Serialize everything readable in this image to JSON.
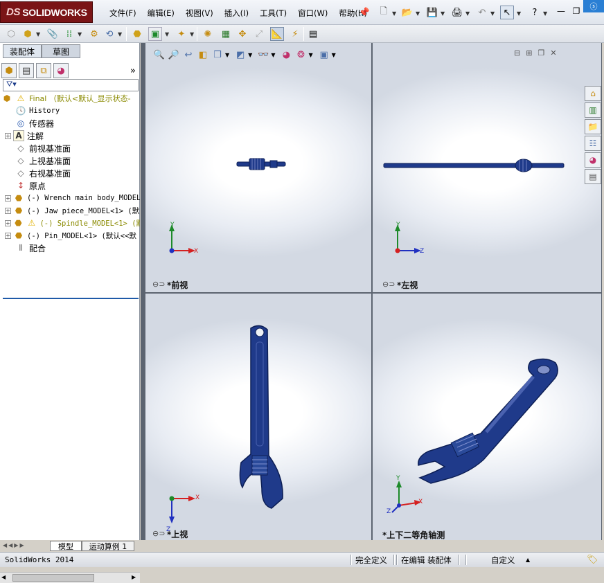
{
  "app": {
    "logo_prefix": "DS",
    "logo_text": "SOLIDWORKS"
  },
  "menu": {
    "items": [
      "文件(F)",
      "编辑(E)",
      "视图(V)",
      "插入(I)",
      "工具(T)",
      "窗口(W)",
      "帮助(H)"
    ]
  },
  "panel_tabs": {
    "assembly": "装配体",
    "sketch": "草图"
  },
  "feature_tree": {
    "root": "Final （默认<默认_显示状态-",
    "items": [
      {
        "label": "History",
        "icon": "history-icon",
        "expander": false
      },
      {
        "label": "传感器",
        "icon": "sensor-icon",
        "expander": false
      },
      {
        "label": "注解",
        "icon": "annotation-icon",
        "expander": true
      },
      {
        "label": "前视基准面",
        "icon": "plane-icon",
        "expander": false
      },
      {
        "label": "上视基准面",
        "icon": "plane-icon",
        "expander": false
      },
      {
        "label": "右视基准面",
        "icon": "plane-icon",
        "expander": false
      },
      {
        "label": "原点",
        "icon": "origin-icon",
        "expander": false
      },
      {
        "label": "(-) Wrench main body_MODEL",
        "icon": "part-icon",
        "expander": true
      },
      {
        "label": "(-) Jaw piece_MODEL<1> (默",
        "icon": "part-icon",
        "expander": true
      },
      {
        "label": "(-) Spindle_MODEL<1> (默",
        "icon": "part-warning-icon",
        "expander": true,
        "warning": true
      },
      {
        "label": "(-) Pin_MODEL<1> (默认<<默",
        "icon": "part-icon",
        "expander": true
      },
      {
        "label": "配合",
        "icon": "mate-icon",
        "expander": false
      }
    ]
  },
  "bottom_tabs": {
    "model": "模型",
    "motion": "运动算例 1"
  },
  "viewports": {
    "front": "*前视",
    "left": "*左视",
    "top": "*上视",
    "iso": "*上下二等角轴测"
  },
  "axes": {
    "x": "X",
    "y": "Y",
    "z": "Z"
  },
  "status": {
    "app_version": "SolidWorks 2014",
    "definition": "完全定义",
    "editing": "在编辑 装配体",
    "units": "自定义"
  },
  "colors": {
    "part_blue": "#1f3a8a",
    "axis_red": "#d42020",
    "axis_green": "#1d8a2a",
    "axis_blue": "#2030c0"
  }
}
